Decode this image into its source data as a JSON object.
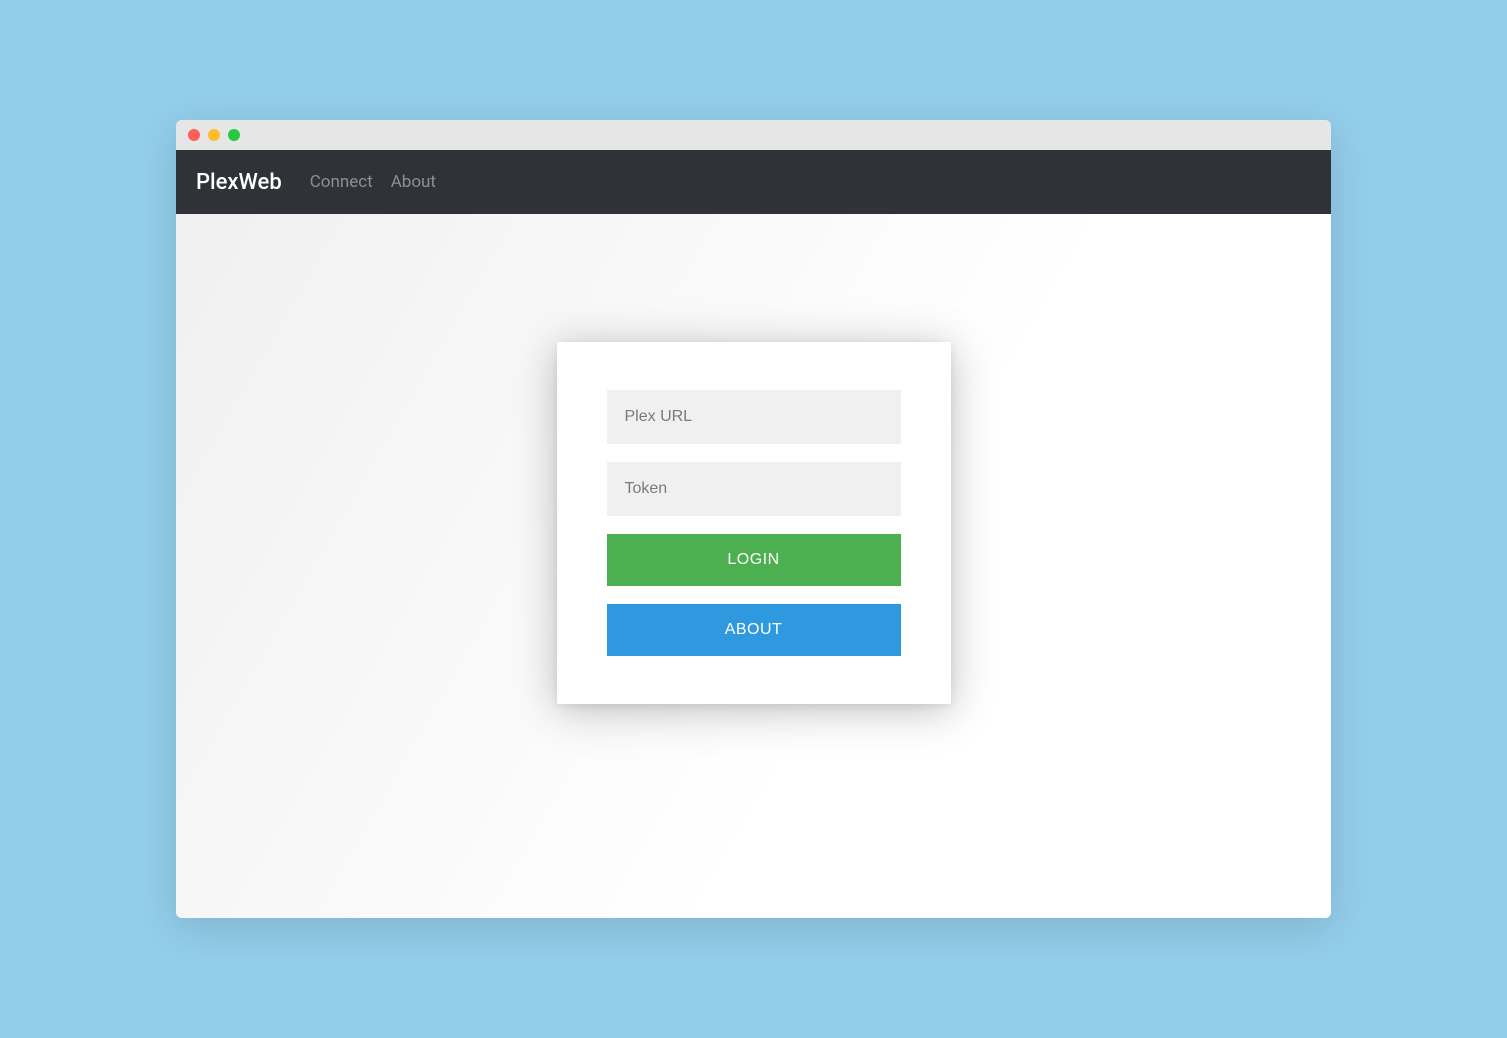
{
  "navbar": {
    "brand": "PlexWeb",
    "links": [
      {
        "label": "Connect"
      },
      {
        "label": "About"
      }
    ]
  },
  "login_card": {
    "url_input": {
      "placeholder": "Plex URL",
      "value": ""
    },
    "token_input": {
      "placeholder": "Token",
      "value": ""
    },
    "login_button_label": "LOGIN",
    "about_button_label": "ABOUT"
  },
  "colors": {
    "page_bg": "#92cdea",
    "navbar_bg": "#2f3338",
    "login_btn": "#4caf50",
    "about_btn": "#2f99df"
  }
}
